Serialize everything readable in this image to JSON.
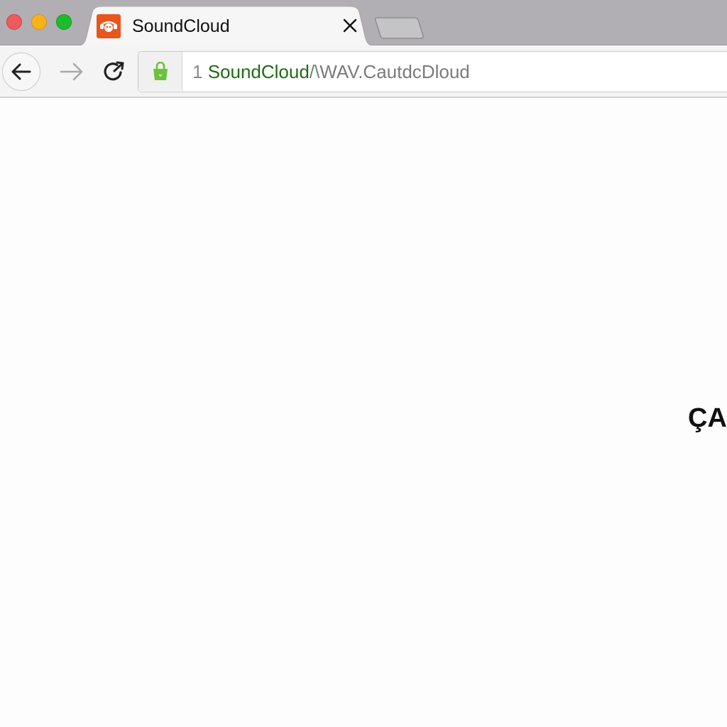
{
  "window": {
    "controls": [
      "close",
      "minimize",
      "maximize"
    ]
  },
  "tabs": [
    {
      "title": "SoundCloud",
      "favicon": "soundcloud-favicon",
      "favicon_color": "#e9561c",
      "active": true,
      "close_icon": "close-icon"
    }
  ],
  "new_tab": {
    "icon": "new-tab-icon"
  },
  "toolbar": {
    "back_icon": "arrow-left-icon",
    "forward_icon": "arrow-right-icon",
    "reload_icon": "reload-icon",
    "security_icon": "shopping-bag-icon",
    "security_icon_color": "#6cc23a"
  },
  "address_bar": {
    "prefix": "1 ",
    "host": "SoundCloud",
    "path": "/\\WAV.CautdcDloud",
    "host_color": "#1f6b16"
  },
  "content": {
    "text": "ÇA"
  }
}
